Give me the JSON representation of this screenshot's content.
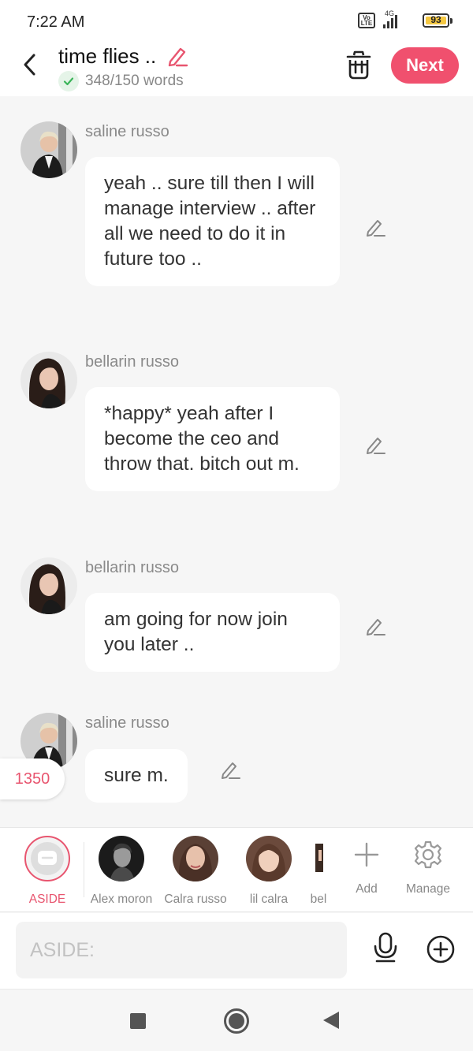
{
  "status": {
    "time": "7:22 AM",
    "network": "4G",
    "volte": "Vo LTE",
    "battery": "93"
  },
  "header": {
    "title": "time flies ..",
    "word_count": "348/150 words",
    "next_label": "Next"
  },
  "messages": [
    {
      "author": "saline russo",
      "text": "yeah .. sure till then I will manage interview .. after all we need to do it in future too .."
    },
    {
      "author": "bellarin russo",
      "text": "*happy* yeah after I become the ceo and throw that. bitch out m."
    },
    {
      "author": "bellarin russo",
      "text": "am going for now join you later .."
    },
    {
      "author": "saline russo",
      "text": "sure m."
    }
  ],
  "count_badge": "1350",
  "characters": [
    {
      "label": "ASIDE"
    },
    {
      "label": "Alex moron"
    },
    {
      "label": "Calra  russo"
    },
    {
      "label": "lil calra"
    },
    {
      "label": "bel"
    }
  ],
  "tools": {
    "add": "Add",
    "manage": "Manage"
  },
  "input": {
    "placeholder": "ASIDE:"
  },
  "colors": {
    "accent": "#f0506e",
    "success": "#3cb55a",
    "background": "#f6f6f6"
  }
}
